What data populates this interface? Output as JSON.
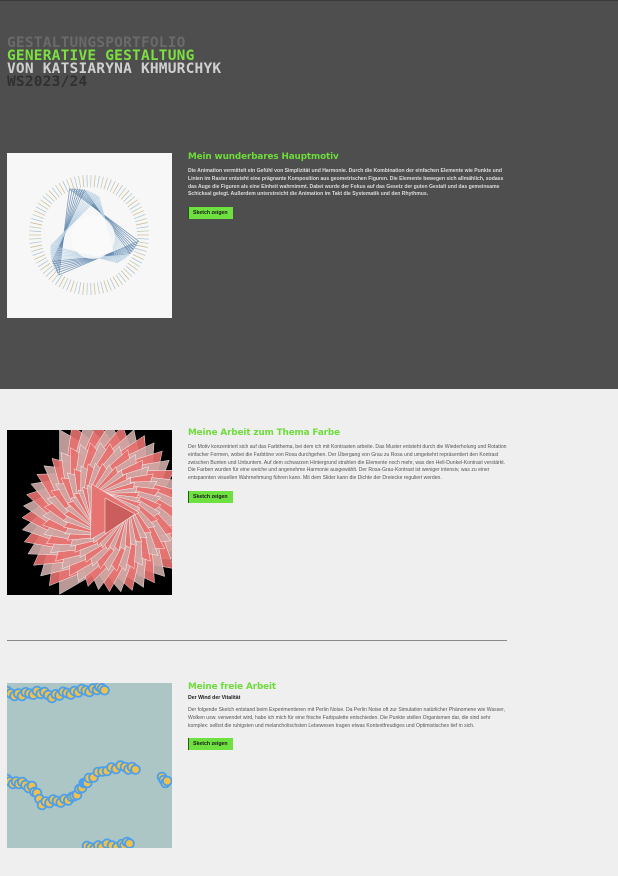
{
  "header": {
    "line1": "GESTALTUNGSPORTFOLIO",
    "line2": "GENERATIVE GESTALTUNG",
    "line3": "VON KATSIARYNA KHMURCHYK",
    "line4": "WS2023/24"
  },
  "sections": [
    {
      "heading": "Mein wunderbares Hauptmotiv",
      "subheading": "",
      "description": "Die Animation vermittelt ein Gefühl von Simplizität und Harmonie. Durch die Kombination der einfachen Elemente wie Punkte und Linien im Raster entsteht eine prägnante Komposition aus geometrischen Figuren. Die Elemente bewegen sich allmählich, sodass das Auge die Figuren als eine Einheit wahrnimmt. Dabei wurde der Fokus auf das Gesetz der guten Gestalt und das gemeinsame Schicksal gelegt. Außerdem unterstreicht die Animation im Takt die Systematik und den Rhythmus.",
      "button": "Sketch zeigen"
    },
    {
      "heading": "Meine Arbeit zum Thema Farbe",
      "subheading": "",
      "description": "Der Motiv konzentriert sich auf das Farbthema, bei dem ich mit Kontrasten arbeite. Das Muster entsteht durch die Wiederholung und Rotation einfacher Formen, wobei die Farbtöne von Rosa durchgehen. Der Übergang von Grau zu Rosa und umgekehrt repräsentiert den Kontrast zwischen Bunten und Unbuntem. Auf dem schwarzen Hintergrund strahlen die Elemente noch mehr, was den Hell-Dunkel-Kontrast verstärkt. Die Farben wurden für eine weiche und angenehme Harmonie ausgewählt. Der Rosa-Grau-Kontrast ist weniger intensiv, was zu einer entspannten visuellen Wahrnehmung führen kann. Mit dem Slider kann die Dichte der Dreiecke reguliert werden.",
      "button": "Sketch zeigen"
    },
    {
      "heading": "Meine freie Arbeit",
      "subheading": "Der Wind der Vitalität",
      "description": "Der folgende Sketch entstand beim Experimentieren mit Perlin Noise. Da Perlin Noise oft zur Simulation natürlicher Phänomene wie Wasser, Wolken usw. verwendet wird, habe ich mich für eine frische Farbpalette entschieden. Die Punkte stellen Organismen dar, die sind sehr komplex: selbst die ruhigsten und melancholischsten Lebewesen tragen etwas Kontextfreudiges und Optimistisches tief in sich.",
      "button": "Sketch zeigen"
    }
  ],
  "colors": {
    "hero_bg": "#4e4e4e",
    "page_bg": "#efefef",
    "accent": "#6ee03f",
    "pink": "#e8706e",
    "dot_blue": "#4aa0ee",
    "dot_yellow": "#f0c04a",
    "sea_bg": "#acc6c6"
  }
}
